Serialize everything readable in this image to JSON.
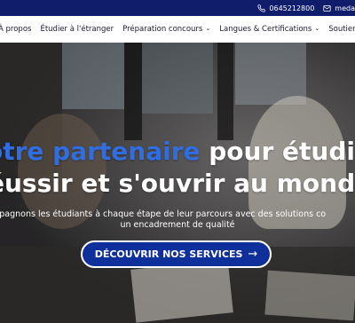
{
  "topbar": {
    "phone": "0645212800",
    "email_partial": "meda",
    "phone_icon": "phone-icon",
    "email_icon": "envelope-icon"
  },
  "nav": {
    "items": [
      {
        "label": "À propos",
        "has_dropdown": false
      },
      {
        "label": "Étudier à l'étranger",
        "has_dropdown": false
      },
      {
        "label": "Préparation concours",
        "has_dropdown": true
      },
      {
        "label": "Langues & Certifications",
        "has_dropdown": true
      },
      {
        "label": "Soutien Sco",
        "has_dropdown": false
      }
    ]
  },
  "hero": {
    "headline_accent": "otre partenaire",
    "headline_rest1": " pour étudie",
    "headline_line2": "éussir et s'ouvrir au monde",
    "subtitle_line1": "mpagnons les étudiants à chaque étape de leur parcours avec des solutions co",
    "subtitle_line2": "un encadrement de qualité",
    "cta_label": "DÉCOUVRIR NOS SERVICES",
    "cta_icon": "arrow-right-icon"
  },
  "colors": {
    "topbar_bg": "#0f1d6b",
    "accent_blue": "#2f6de0",
    "cta_bg": "#0f2f9a"
  }
}
